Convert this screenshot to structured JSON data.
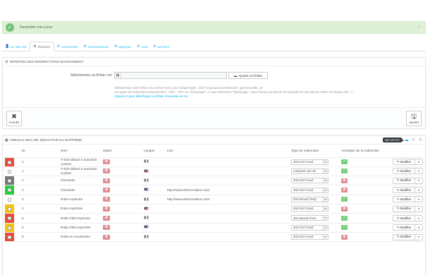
{
  "alert": {
    "message": "Paramètre mis à jour",
    "close": "×"
  },
  "tabs": [
    {
      "label": "EC SEO 301",
      "icon": "user-icon",
      "glyph": "👤"
    },
    {
      "label": "PRODUIT",
      "icon": "cogs-icon",
      "glyph": "⚙"
    },
    {
      "label": "CATÉGORIE",
      "icon": "cogs-icon",
      "glyph": "⚙"
    },
    {
      "label": "FOURNISSEUR",
      "icon": "cogs-icon",
      "glyph": "⚙"
    },
    {
      "label": "MARQUE",
      "icon": "cogs-icon",
      "glyph": "⚙"
    },
    {
      "label": "CMS",
      "icon": "cogs-icon",
      "glyph": "⚙"
    },
    {
      "label": "AUTRES",
      "icon": "cogs-icon",
      "glyph": "⚙"
    }
  ],
  "import_panel": {
    "title": "IMPORTEZ DES REDIRECTIONS MASSIVEMENT",
    "file_label": "Sélectionnez un fichier csv",
    "file_value": "",
    "add_file": "Ajouter un fichier",
    "help_line1": "Sélectionnez votre fichier csv comme ceci, pour chaque ligne : id;id_lang;autorun;redirection_type;nouvelle_url.",
    "help_line2": "Les types de redirections peuvent être : \"301\", \"302\" ou \"homepage\", si vous choisissez \"homepage\", vous n'avez pas besoin de nouvelle url mais devez mettre un champ vide \";;\"",
    "help_link": "Cliquez ici pour télécharger un fichier d'exemple en csv",
    "cancel_label": "Annuler",
    "import_label": "Ajouter"
  },
  "table_panel": {
    "title": "TABLEAU DES URL DÉSACTIVÉ OU SUPPRIMÉ",
    "import_badge": "IMPORTER",
    "columns": {
      "id": "ID",
      "name": "Nom",
      "status": "Statut",
      "lang": "Langue",
      "link": "Lien",
      "type": "Type de redirection",
      "active": "Activation de la redirection"
    },
    "rows": [
      {
        "color": "#e74c3c",
        "id": "1",
        "name": "T-shirt délavé à manches courtes",
        "status": "off",
        "lang": "fr",
        "link": "",
        "type": "404 Not Found",
        "active": "on",
        "action": "Modifier"
      },
      {
        "color": "",
        "id": "1",
        "name": "T-shirt délavé à manches courtes",
        "status": "off",
        "lang": "en",
        "link": "",
        "type": "Catégorie par dé",
        "active": "on",
        "action": "Modifier"
      },
      {
        "color": "#777777",
        "id": "2",
        "name": "Chemisier",
        "status": "off",
        "lang": "fr",
        "link": "",
        "type": "404 Not Found",
        "active": "off",
        "action": "Modifier"
      },
      {
        "color": "#2ecc40",
        "id": "2",
        "name": "Chemisier",
        "status": "off",
        "lang": "en",
        "link": "http://www.ethercreation.com/",
        "type": "404 Not Found",
        "active": "off",
        "action": "Modifier"
      },
      {
        "color": "",
        "id": "4",
        "name": "Robe imprimée",
        "status": "off",
        "lang": "fr",
        "link": "http://www.ethercreation.com/",
        "type": "302 Moved Temp",
        "active": "on",
        "action": "Modifier"
      },
      {
        "color": "#f1c40f",
        "id": "4",
        "name": "Robe imprimée",
        "status": "off",
        "lang": "en",
        "link": "",
        "type": "404 Not Found",
        "active": "off",
        "action": "Modifier"
      },
      {
        "color": "#e74c3c",
        "id": "5",
        "name": "Robe d'été imprimée",
        "status": "off",
        "lang": "fr",
        "link": "",
        "type": "301 Moved Perm",
        "active": "on",
        "action": "Modifier"
      },
      {
        "color": "#f1c40f",
        "id": "5",
        "name": "Robe d'été imprimée",
        "status": "off",
        "lang": "en",
        "link": "",
        "type": "404 Not Found",
        "active": "on",
        "action": "Modifier"
      },
      {
        "color": "#e74c3c",
        "id": "9",
        "name": "Robe en mousseline",
        "status": "off",
        "lang": "fr",
        "link": "",
        "type": "404 Not Found",
        "active": "off",
        "action": "Modifier"
      }
    ]
  }
}
